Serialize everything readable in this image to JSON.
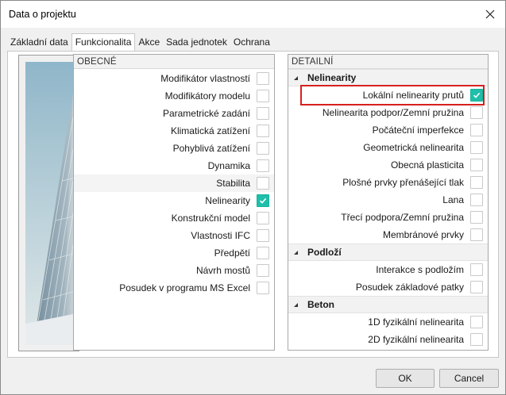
{
  "window": {
    "title": "Data o projektu"
  },
  "tabs": [
    {
      "label": "Základní data",
      "active": false
    },
    {
      "label": "Funkcionalita",
      "active": true
    },
    {
      "label": "Akce",
      "active": false
    },
    {
      "label": "Sada jednotek",
      "active": false
    },
    {
      "label": "Ochrana",
      "active": false
    }
  ],
  "general": {
    "header": "OBECNÉ",
    "items": [
      {
        "label": "Modifikátor vlastností",
        "checked": false
      },
      {
        "label": "Modifikátory modelu",
        "checked": false
      },
      {
        "label": "Parametrické zadání",
        "checked": false
      },
      {
        "label": "Klimatická zatížení",
        "checked": false
      },
      {
        "label": "Pohyblivá zatížení",
        "checked": false
      },
      {
        "label": "Dynamika",
        "checked": false
      },
      {
        "label": "Stabilita",
        "checked": false,
        "selected": true
      },
      {
        "label": "Nelinearity",
        "checked": true
      },
      {
        "label": "Konstrukční model",
        "checked": false
      },
      {
        "label": "Vlastnosti IFC",
        "checked": false
      },
      {
        "label": "Předpětí",
        "checked": false
      },
      {
        "label": "Návrh mostů",
        "checked": false
      },
      {
        "label": "Posudek v programu MS Excel",
        "checked": false
      }
    ]
  },
  "detail": {
    "header": "DETAILNÍ",
    "sections": [
      {
        "name": "Nelinearity",
        "items": [
          {
            "label": "Lokální nelinearity prutů",
            "checked": true
          },
          {
            "label": "Nelinearita podpor/Zemní pružina",
            "checked": false
          },
          {
            "label": "Počáteční imperfekce",
            "checked": false
          },
          {
            "label": "Geometrická nelinearita",
            "checked": false
          },
          {
            "label": "Obecná plasticita",
            "checked": false
          },
          {
            "label": "Plošné prvky přenášející tlak",
            "checked": false
          },
          {
            "label": "Lana",
            "checked": false
          },
          {
            "label": "Třecí podpora/Zemní pružina",
            "checked": false
          },
          {
            "label": "Membránové prvky",
            "checked": false
          }
        ]
      },
      {
        "name": "Podloží",
        "items": [
          {
            "label": "Interakce s podložím",
            "checked": false
          },
          {
            "label": "Posudek základové patky",
            "checked": false
          }
        ]
      },
      {
        "name": "Beton",
        "items": [
          {
            "label": "1D fyzikální nelinearita",
            "checked": false
          },
          {
            "label": "2D fyzikální nelinearita",
            "checked": false
          }
        ]
      }
    ]
  },
  "buttons": {
    "ok": "OK",
    "cancel": "Cancel"
  },
  "colors": {
    "check": "#1fbfaa",
    "highlight": "#d62020"
  }
}
